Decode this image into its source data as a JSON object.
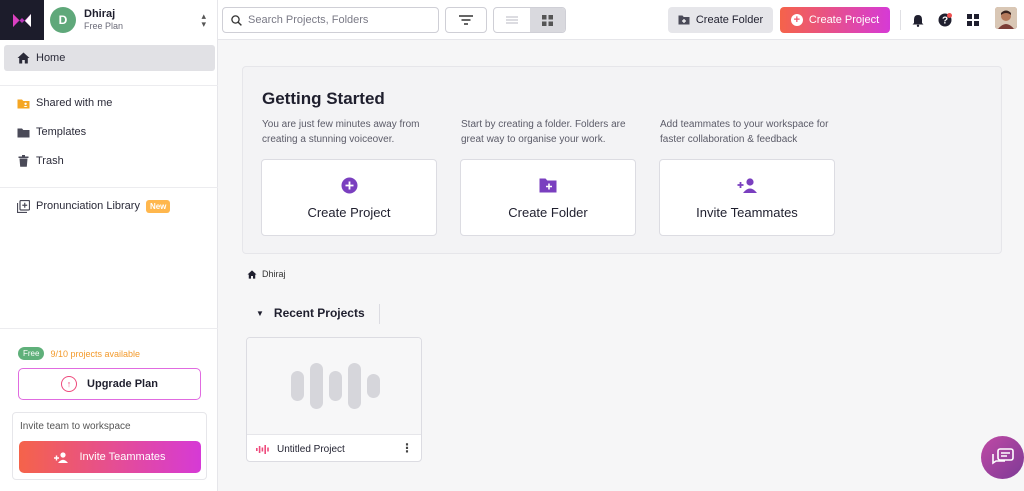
{
  "colors": {
    "accent_gradient_start": "#f5634a",
    "accent_gradient_end": "#d63ad6",
    "purple_icon": "#7a3fbf",
    "sidebar_bg": "#ffffff",
    "logo_bg": "#1c1c2b"
  },
  "account": {
    "initial": "D",
    "name": "Dhiraj",
    "plan": "Free Plan"
  },
  "sidebar": {
    "items": [
      {
        "label": "Home",
        "icon": "home-icon",
        "active": true
      },
      {
        "label": "Shared with me",
        "icon": "shared-folder-icon"
      },
      {
        "label": "Templates",
        "icon": "folder-icon"
      },
      {
        "label": "Trash",
        "icon": "trash-icon"
      },
      {
        "label": "Pronunciation Library",
        "icon": "library-add-icon",
        "badge": "New"
      }
    ],
    "free_badge": "Free",
    "projects_available": "9/10 projects available",
    "upgrade_label": "Upgrade Plan",
    "invite_title": "Invite team to workspace",
    "invite_label": "Invite Teammates"
  },
  "topbar": {
    "search_placeholder": "Search Projects, Folders",
    "create_folder_label": "Create Folder",
    "create_project_label": "Create Project",
    "icons": [
      "bell-icon",
      "help-icon",
      "apps-grid-icon",
      "user-avatar"
    ]
  },
  "getting_started": {
    "title": "Getting Started",
    "columns": [
      {
        "desc": "You are just few minutes away from creating a stunning voiceover.",
        "card_label": "Create Project",
        "icon": "plus-circle-icon"
      },
      {
        "desc": "Start by creating a folder. Folders are great way to organise your work.",
        "card_label": "Create Folder",
        "icon": "folder-plus-icon"
      },
      {
        "desc": "Add teammates to your workspace for faster collaboration & feedback",
        "card_label": "Invite Teammates",
        "icon": "person-add-icon"
      }
    ]
  },
  "breadcrumb": {
    "label": "Dhiraj"
  },
  "recent": {
    "title": "Recent Projects",
    "projects": [
      {
        "name": "Untitled Project"
      }
    ]
  }
}
